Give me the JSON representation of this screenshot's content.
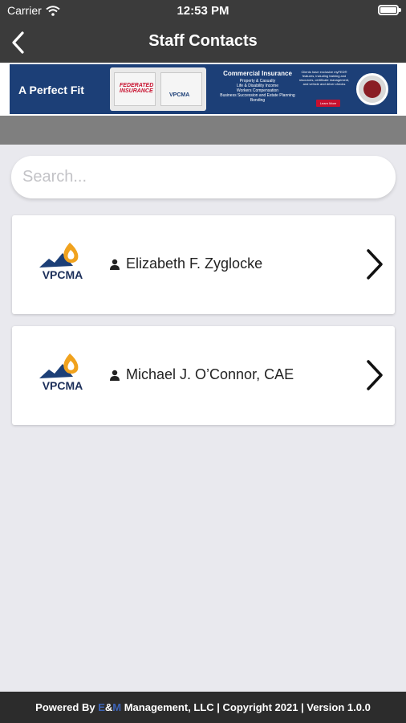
{
  "status_bar": {
    "carrier": "Carrier",
    "time": "12:53 PM"
  },
  "nav": {
    "title": "Staff Contacts",
    "back_icon": "chevron-left-icon"
  },
  "banner": {
    "tagline": "A Perfect Fit",
    "partner_left": "FEDERATED INSURANCE",
    "partner_right": "VPCMA",
    "heading": "Commercial Insurance",
    "lines": [
      "Property & Casualty",
      "Life & Disability Income",
      "Workers Compensation",
      "Business Succession and Estate Planning",
      "Bonding"
    ],
    "side_text": "Clients have exclusive myFED® features, including training and resources, certificate management, and vehicle and driver checks",
    "cta": "Learn More"
  },
  "search": {
    "placeholder": "Search..."
  },
  "contacts": [
    {
      "name": "Elizabeth F. Zyglocke",
      "logo_text": "VPCMA"
    },
    {
      "name": "Michael J. O’Connor, CAE",
      "logo_text": "VPCMA"
    }
  ],
  "footer": {
    "prefix": "Powered By ",
    "brand_e": "E",
    "amp": "&",
    "brand_m": "M",
    "suffix": " Management, LLC | Copyright 2021 | Version 1.0.0"
  },
  "colors": {
    "header": "#3b3b3b",
    "banner_blue": "#1c3f77",
    "accent_red": "#c8102e",
    "background": "#e9e9ee"
  }
}
